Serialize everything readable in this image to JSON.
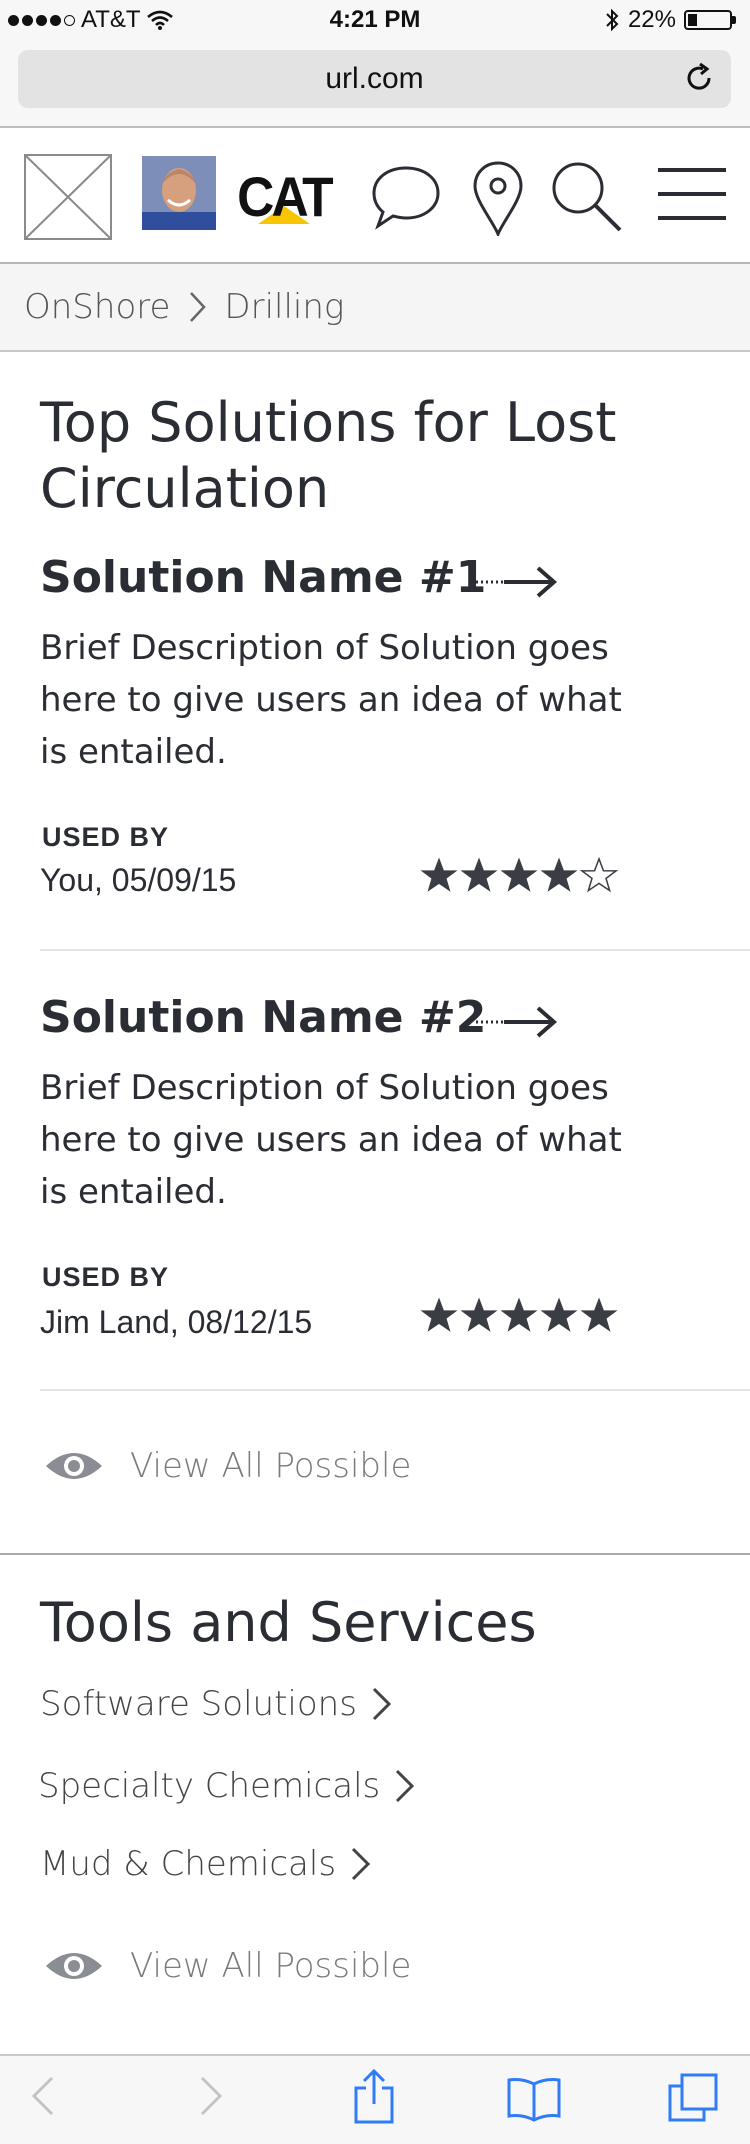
{
  "status_bar": {
    "carrier": "AT&T",
    "time": "4:21 PM",
    "battery_percent": "22%",
    "battery_level": 0.22
  },
  "browser": {
    "url": "url.com"
  },
  "nav": {
    "logo_text": "CAT",
    "icons": [
      "placeholder-image-icon",
      "avatar",
      "cat-logo",
      "chat-icon",
      "location-pin-icon",
      "search-icon",
      "hamburger-menu-icon"
    ]
  },
  "breadcrumb": {
    "items": [
      "OnShore",
      "Drilling"
    ]
  },
  "top_solutions": {
    "title_line1": "Top Solutions for Lost",
    "title_line2": "Circulation",
    "solutions": [
      {
        "name": "Solution Name #1",
        "desc_line1": "Brief Description of Solution goes",
        "desc_line2": "here to give users an idea of what",
        "desc_line3": "is entailed.",
        "used_by_label": "USED BY",
        "used_by": "You, 05/09/15",
        "rating": 4
      },
      {
        "name": "Solution Name #2",
        "desc_line1": "Brief Description of Solution goes",
        "desc_line2": "here to give users an idea of what",
        "desc_line3": "is entailed.",
        "used_by_label": "USED BY",
        "used_by": "Jim Land, 08/12/15",
        "rating": 5
      }
    ],
    "view_all": "View All Possible"
  },
  "tools": {
    "title": "Tools and Services",
    "links": [
      "Software Solutions",
      "Specialty Chemicals",
      "Mud & Chemicals"
    ],
    "view_all": "View All Possible"
  },
  "colors": {
    "text": "#2a2d33",
    "muted": "#7b7b7b",
    "ios_blue": "#2f7cf6",
    "cat_yellow": "#f7c600"
  }
}
